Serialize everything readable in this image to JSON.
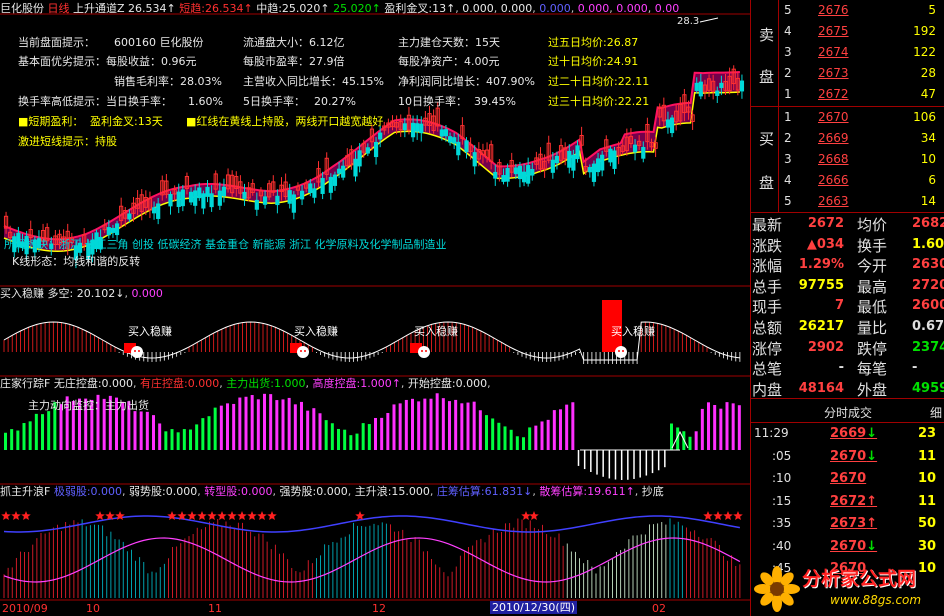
{
  "header": {
    "name": "巨化股份",
    "period": "日线",
    "indicator": "上升通道Z",
    "v1": "26.534↑",
    "v2_label": "短趋:",
    "v2": "26.534↑",
    "v3_label": "中趋:",
    "v3": "25.020↑",
    "v4": "25.020↑",
    "v5_label": "盈利金叉:",
    "v5": "13↑",
    "v6": "0.000",
    "v7": "0.000",
    "v8": "0.000",
    "v9": "0.000",
    "v10": "0.000",
    "v11": "0.00",
    "peak": "28.3"
  },
  "info": {
    "r1": [
      "当前盘面提示：",
      "600160 巨化股份",
      "流通盘大小：6.12亿",
      "主力建仓天数：15天",
      "过五日均价:26.87"
    ],
    "r2": [
      "基本面优劣提示：每股收益：0.96元",
      "每股市盈率：27.9倍",
      "每股净资产：4.00元",
      "过十日均价:24.91"
    ],
    "r3": [
      "销售毛利率：28.03%",
      "主营收入同比增长：45.15%",
      "净利润同比增长：407.90%",
      "过二十日均价:22.11"
    ],
    "r4": [
      "换手率高低提示：当日换手率：",
      "1.60%",
      "5日换手率：",
      "20.27%",
      "10日换手率：",
      "39.45%",
      "过三十日均价:22.21"
    ],
    "r5a": "■短期盈利：",
    "r5b": "盈利金叉:13天",
    "r5c": "■红线在黄线上持股，两线开口越宽越好",
    "r6": "激进短线提示：持股",
    "sectors": "所属板块：浙江 长江三角 创投 低碳经济 基金重仓 新能源 浙江 化学原料及化学制品制造业",
    "sectors2": "K线形态：均线和谐的反转"
  },
  "panel2": {
    "title": "买入稳赚",
    "label": "多空:",
    "v1": "20.102↓",
    "v2": "0.000",
    "tags": [
      "买入稳赚",
      "买入稳赚",
      "买入稳赚",
      "买入稳赚"
    ]
  },
  "panel3": {
    "title": "庄家行踪F",
    "a_label": "无庄控盘:",
    "a": "0.000",
    "b_label": "有庄控盘:",
    "b": "0.000",
    "c_label": "主力出货:",
    "c": "1.000",
    "d_label": "高度控盘:",
    "d": "1.000↑",
    "e_label": "开始控盘:",
    "e": "0.000",
    "sub": "主力动向监控：主力出货"
  },
  "panel4": {
    "title": "抓主升浪F",
    "a_label": "极弱股:",
    "a": "0.000",
    "b_label": "弱势股:",
    "b": "0.000",
    "c_label": "转型股:",
    "c": "0.000",
    "d_label": "强势股:",
    "d": "0.000",
    "e_label": "主升浪:",
    "e": "15.000",
    "f_label": "庄筹估算:",
    "f": "61.831↓",
    "g_label": "散筹估算:",
    "g": "19.611↑",
    "h": "抄底"
  },
  "xaxis": {
    "labels": [
      "2010/09",
      "10",
      "11",
      "12",
      "2010/12/30(四)",
      "02"
    ]
  },
  "orderbook": {
    "sell_label": [
      "卖",
      "盘"
    ],
    "buy_label": [
      "买",
      "盘"
    ],
    "sell": [
      {
        "lv": "5",
        "price": "2676",
        "vol": "5"
      },
      {
        "lv": "4",
        "price": "2675",
        "vol": "192"
      },
      {
        "lv": "3",
        "price": "2674",
        "vol": "122"
      },
      {
        "lv": "2",
        "price": "2673",
        "vol": "28"
      },
      {
        "lv": "1",
        "price": "2672",
        "vol": "47"
      }
    ],
    "buy": [
      {
        "lv": "1",
        "price": "2670",
        "vol": "106"
      },
      {
        "lv": "2",
        "price": "2669",
        "vol": "34"
      },
      {
        "lv": "3",
        "price": "2668",
        "vol": "10"
      },
      {
        "lv": "4",
        "price": "2666",
        "vol": "6"
      },
      {
        "lv": "5",
        "price": "2663",
        "vol": "14"
      }
    ]
  },
  "quote": [
    {
      "l": "最新",
      "v": "2672",
      "l2": "均价",
      "v2": "2682"
    },
    {
      "l": "涨跌",
      "v": "▲034",
      "l2": "换手",
      "v2": "1.60%"
    },
    {
      "l": "涨幅",
      "v": "1.29%",
      "l2": "今开",
      "v2": "2630"
    },
    {
      "l": "总手",
      "v": "97755",
      "l2": "最高",
      "v2": "2720"
    },
    {
      "l": "现手",
      "v": "7",
      "l2": "最低",
      "v2": "2600"
    },
    {
      "l": "总额",
      "v": "26217",
      "l2": "量比",
      "v2": "0.67"
    },
    {
      "l": "涨停",
      "v": "2902",
      "l2": "跌停",
      "v2": "2374"
    },
    {
      "l": "总笔",
      "v": "-",
      "l2": "每笔",
      "v2": "-"
    },
    {
      "l": "内盘",
      "v": "48164",
      "l2": "外盘",
      "v2": "49591"
    }
  ],
  "ticks_header": {
    "t1": "分时成交",
    "t2": "细"
  },
  "ticks": [
    {
      "time": "11:29",
      "price": "2669↓",
      "vol": "23"
    },
    {
      "time": ":05",
      "price": "2670↓",
      "vol": "11"
    },
    {
      "time": ":10",
      "price": "2670",
      "vol": "10"
    },
    {
      "time": ":15",
      "price": "2672↑",
      "vol": "11"
    },
    {
      "time": ":35",
      "price": "2673↑",
      "vol": "50"
    },
    {
      "time": ":40",
      "price": "2670↓",
      "vol": "30"
    },
    {
      "time": ":45",
      "price": "2670",
      "vol": "10"
    }
  ],
  "watermark": {
    "text": "分析家公式网",
    "url": "www.88gs.com"
  }
}
